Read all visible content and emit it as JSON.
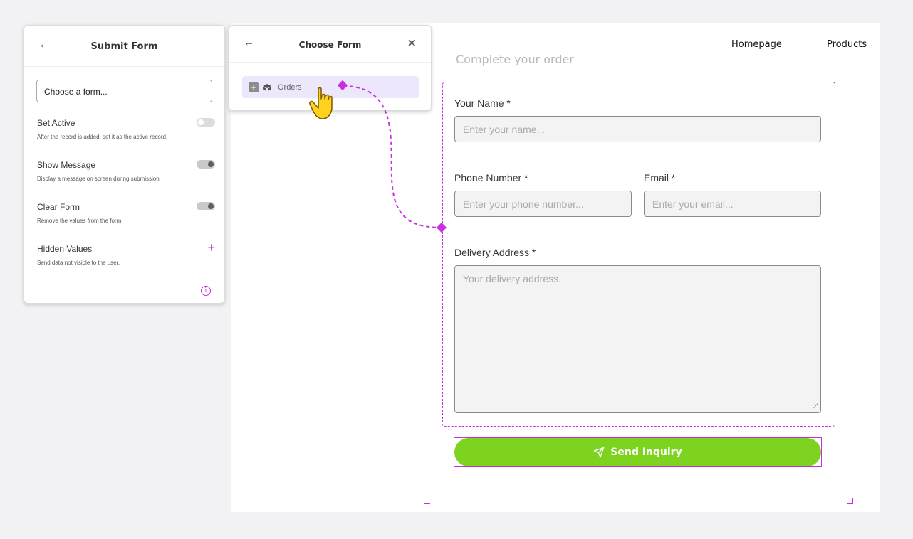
{
  "canvas": {
    "nav": {
      "homepage": "Homepage",
      "products": "Products"
    },
    "form": {
      "heading": "Complete your order",
      "name_label": "Your Name *",
      "name_placeholder": "Enter your name...",
      "phone_label": "Phone Number *",
      "phone_placeholder": "Enter your phone number...",
      "email_label": "Email *",
      "email_placeholder": "Enter your email...",
      "address_label": "Delivery Address *",
      "address_placeholder": "Your delivery address.",
      "submit_label": "Send Inquiry"
    }
  },
  "submit_panel": {
    "title": "Submit Form",
    "choose_placeholder": "Choose a form...",
    "settings": [
      {
        "title": "Set Active",
        "description": "After the record is added, set it as the active record."
      },
      {
        "title": "Show Message",
        "description": "Display a message on screen during submission."
      },
      {
        "title": "Clear Form",
        "description": "Remove the values from the form."
      },
      {
        "title": "Hidden Values",
        "description": "Send data not visible to the user."
      }
    ]
  },
  "choose_panel": {
    "title": "Choose Form",
    "option": "Orders"
  },
  "colors": {
    "accent": "#c92ee0",
    "submit_button": "#7ed321",
    "option_highlight": "#ede7fb"
  }
}
